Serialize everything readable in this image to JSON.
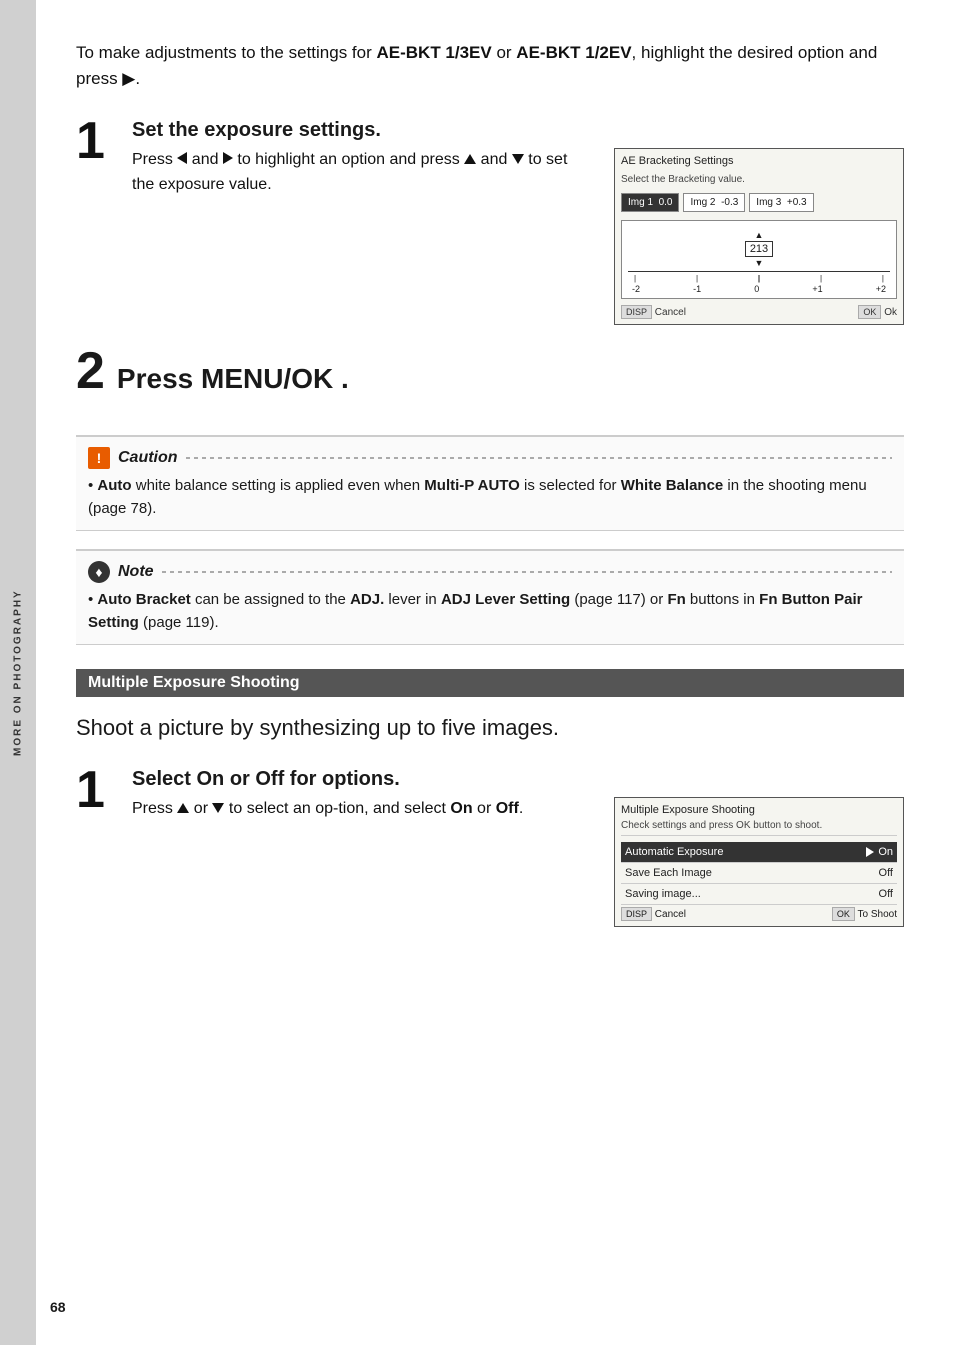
{
  "page": {
    "number": "68",
    "sidebar_text": "More on Photography"
  },
  "intro": {
    "text": "To make adjustments to the settings for AE-BKT 1/3EV or AE-BKT 1/2EV, highlight the desired option and press ▶."
  },
  "step1": {
    "number": "1",
    "title": "Set the exposure settings.",
    "description": "Press ◀ and ▶ to highlight an option and press ▲ and ▼ to set the exposure value.",
    "screen": {
      "title": "AE Bracketing Settings",
      "subtitle": "Select the Bracketing value.",
      "img1": "Img 1",
      "img1_val": "0.0",
      "img2": "Img 2",
      "img2_val": "-0.3",
      "img3": "Img 3",
      "img3_val": "+0.3",
      "scale_labels": [
        "-2",
        "-1",
        "0",
        "+1",
        "+2"
      ],
      "marker_label": "213",
      "cancel": "Cancel",
      "ok": "Ok"
    }
  },
  "step2": {
    "number": "2",
    "title": "Press MENU/OK ."
  },
  "caution": {
    "icon": "!",
    "title": "Caution",
    "body": "Auto white balance setting is applied even when Multi-P AUTO is selected for White Balance in the shooting menu (page 78)."
  },
  "note": {
    "icon": "♦",
    "title": "Note",
    "body": "Auto Bracket can be assigned to the ADJ. lever in ADJ Lever Setting (page 117) or Fn buttons in Fn Button Pair Setting (page 119)."
  },
  "section": {
    "header": "Multiple Exposure Shooting",
    "intro": "Shoot a picture by synthesizing up to five images."
  },
  "step3": {
    "number": "1",
    "title": "Select On or Off for options.",
    "description_line1": "Press ▲ or ▼ to select an op-",
    "description_line2": "tion, and select On or Off.",
    "screen": {
      "title": "Multiple Exposure Shooting",
      "subtitle": "Check settings and press OK button to shoot.",
      "rows": [
        {
          "label": "Automatic Exposure",
          "value": "On",
          "highlighted": true,
          "arrow": true
        },
        {
          "label": "Save Each Image",
          "value": "Off",
          "highlighted": false
        },
        {
          "label": "Saving image...",
          "value": "Off",
          "highlighted": false
        }
      ],
      "cancel": "Cancel",
      "ok": "To Shoot"
    }
  }
}
